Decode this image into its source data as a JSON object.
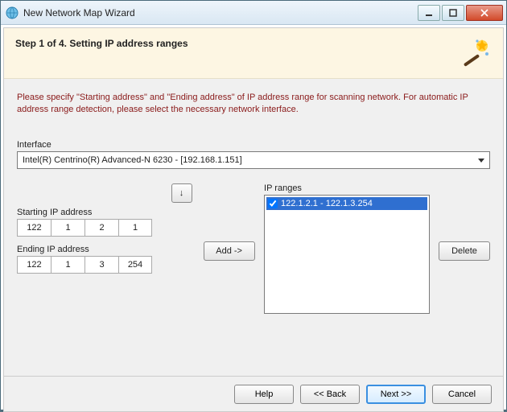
{
  "window": {
    "title": "New Network Map Wizard"
  },
  "header": {
    "step_title": "Step 1 of 4. Setting IP address ranges"
  },
  "instruction": "Please specify \"Starting address\" and \"Ending address\" of IP address range for scanning network. For automatic IP address range detection, please select the necessary network interface.",
  "interface": {
    "label": "Interface",
    "selected": "Intel(R) Centrino(R) Advanced-N 6230 - [192.168.1.151]"
  },
  "start": {
    "label": "Starting IP address",
    "oct1": "122",
    "oct2": "1",
    "oct3": "2",
    "oct4": "1"
  },
  "end": {
    "label": "Ending IP address",
    "oct1": "122",
    "oct2": "1",
    "oct3": "3",
    "oct4": "254"
  },
  "swap_glyph": "↓",
  "buttons": {
    "add": "Add ->",
    "delete": "Delete",
    "help": "Help",
    "back": "<< Back",
    "next": "Next >>",
    "cancel": "Cancel"
  },
  "ranges": {
    "label": "IP ranges",
    "items": [
      {
        "text": "122.1.2.1 - 122.1.3.254",
        "checked": true,
        "selected": true
      }
    ]
  }
}
